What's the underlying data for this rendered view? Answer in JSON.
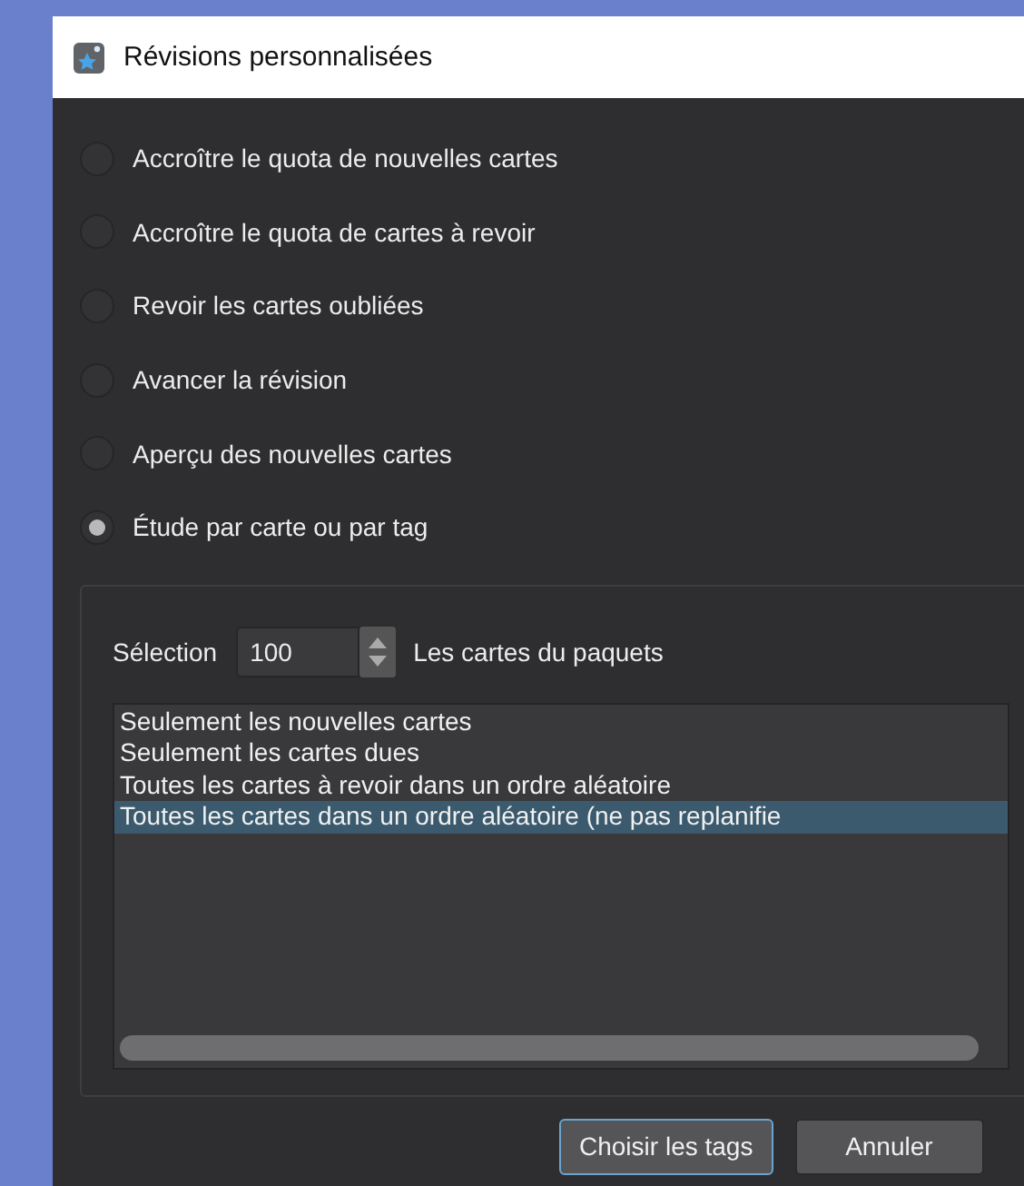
{
  "window": {
    "title": "Révisions personnalisées"
  },
  "options": [
    {
      "label": "Accroître le quota de nouvelles cartes",
      "selected": false
    },
    {
      "label": "Accroître le quota de cartes à revoir",
      "selected": false
    },
    {
      "label": "Revoir les cartes oubliées",
      "selected": false
    },
    {
      "label": "Avancer la révision",
      "selected": false
    },
    {
      "label": "Aperçu des nouvelles cartes",
      "selected": false
    },
    {
      "label": "Étude par carte ou par tag",
      "selected": true
    }
  ],
  "selection": {
    "label": "Sélection",
    "value": "100",
    "suffix": "Les cartes du paquets"
  },
  "list": [
    {
      "label": "Seulement les nouvelles cartes",
      "selected": false
    },
    {
      "label": "Seulement les cartes dues",
      "selected": false
    },
    {
      "label": "Toutes les cartes à revoir dans un ordre aléatoire",
      "selected": false
    },
    {
      "label": "Toutes les cartes dans un ordre aléatoire (ne pas replanifie",
      "selected": true
    }
  ],
  "buttons": [
    {
      "label": "Choisir les tags",
      "default": true
    },
    {
      "label": "Annuler",
      "default": false
    }
  ]
}
